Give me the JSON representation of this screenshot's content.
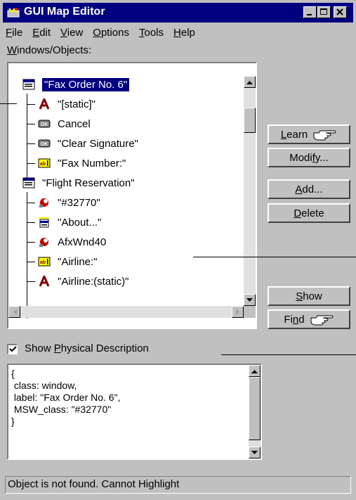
{
  "window": {
    "title": "GUI Map Editor",
    "accent_color": "#000080",
    "face_color": "#c0c0c0"
  },
  "menu": [
    {
      "label": "File",
      "mnemonic": "F",
      "rest": "ile"
    },
    {
      "label": "Edit",
      "mnemonic": "E",
      "rest": "dit"
    },
    {
      "label": "View",
      "mnemonic": "V",
      "rest": "iew"
    },
    {
      "label": "Options",
      "mnemonic": "O",
      "rest": "ptions"
    },
    {
      "label": "Tools",
      "mnemonic": "T",
      "rest": "ools"
    },
    {
      "label": "Help",
      "mnemonic": "H",
      "rest": "elp"
    }
  ],
  "windows_objects_label_mn": "W",
  "windows_objects_label_rest": "indows/Objects:",
  "tree": [
    {
      "label": "\"Fax Order No. 6\"",
      "icon": "window-icon",
      "selected": true
    },
    {
      "label": "\"[static]\"",
      "icon": "static-text-icon"
    },
    {
      "label": "Cancel",
      "icon": "push-button-icon"
    },
    {
      "label": "\"Clear Signature\"",
      "icon": "push-button-icon"
    },
    {
      "label": "\"Fax Number:\"",
      "icon": "edit-field-icon"
    },
    {
      "label": "\"Flight Reservation\"",
      "icon": "window-icon"
    },
    {
      "label": "\"#32770\"",
      "icon": "object-icon"
    },
    {
      "label": "\"About...\"",
      "icon": "menu-item-icon"
    },
    {
      "label": "AfxWnd40",
      "icon": "object-icon"
    },
    {
      "label": "\"Airline:\"",
      "icon": "edit-field-icon"
    },
    {
      "label": "\"Airline:(static)\"",
      "icon": "static-text-icon"
    }
  ],
  "buttons": {
    "learn_mn": "L",
    "learn_rest": "earn",
    "modify_pre": "Modi",
    "modify_mn": "f",
    "modify_post": "y...",
    "add_mn": "A",
    "add_rest": "dd...",
    "delete_mn": "D",
    "delete_rest": "elete",
    "show_mn": "S",
    "show_rest": "how",
    "find_pre": "Fi",
    "find_mn": "n",
    "find_post": "d"
  },
  "show_physical": {
    "checked": true,
    "pre": "Show ",
    "mn": "P",
    "post": "hysical Description"
  },
  "description_text": "{\n class: window,\n label: \"Fax Order No. 6\",\n MSW_class: \"#32770\"\n}",
  "status": "Object is not found. Cannot Highlight"
}
